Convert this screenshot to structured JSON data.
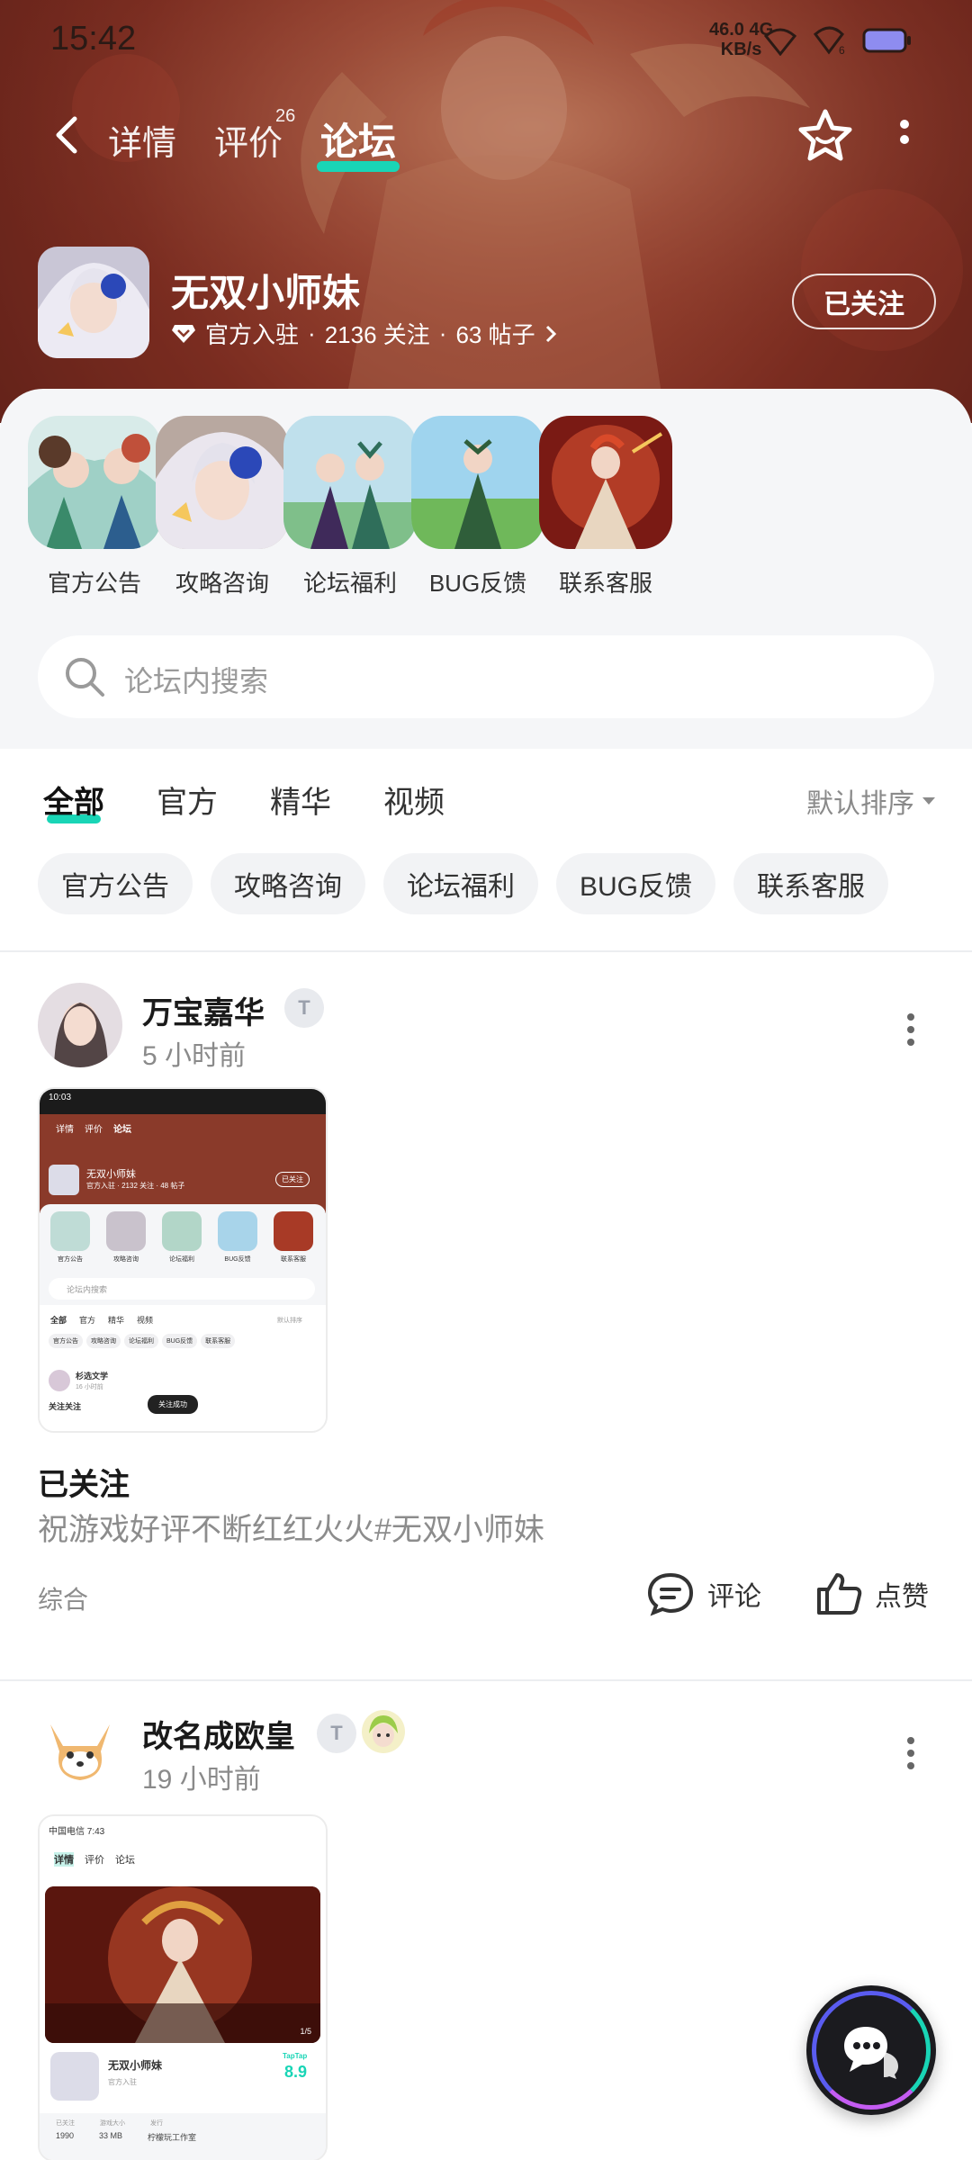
{
  "status_bar": {
    "time": "15:42",
    "net_speed_top": "46.0 4G",
    "net_speed_bottom": "KB/s",
    "signal_sub": "6"
  },
  "nav": {
    "tabs": [
      "详情",
      "评价",
      "论坛"
    ],
    "review_count": "26",
    "active_tab": "论坛"
  },
  "game": {
    "name": "无双小师妹",
    "badge": "官方入驻",
    "follows": "2136 关注",
    "posts": "63 帖子",
    "follow_button": "已关注"
  },
  "categories": [
    {
      "label": "官方公告",
      "icon": "announcement-art"
    },
    {
      "label": "攻略咨询",
      "icon": "guide-art"
    },
    {
      "label": "论坛福利",
      "icon": "welfare-art"
    },
    {
      "label": "BUG反馈",
      "icon": "bug-feedback-art"
    },
    {
      "label": "联系客服",
      "icon": "support-art"
    }
  ],
  "search": {
    "placeholder": "论坛内搜索"
  },
  "filter_tabs": [
    "全部",
    "官方",
    "精华",
    "视频"
  ],
  "sort_label": "默认排序",
  "chips": [
    "官方公告",
    "攻略咨询",
    "论坛福利",
    "BUG反馈",
    "联系客服"
  ],
  "posts": [
    {
      "author": "万宝嘉华",
      "badge": "T",
      "time": "5 小时前",
      "title": "已关注",
      "body": "祝游戏好评不断红红火火#无双小师妹",
      "tag": "综合",
      "comment_label": "评论",
      "like_label": "点赞",
      "screenshot": {
        "time": "10:03",
        "tabs": [
          "详情",
          "评价",
          "论坛"
        ],
        "game": "无双小师妹",
        "meta": "官方入驻 · 2132 关注 · 48 帖子",
        "follow": "已关注",
        "cats": [
          "官方公告",
          "攻略咨询",
          "论坛福利",
          "BUG反馈",
          "联系客服"
        ],
        "search": "论坛内搜索",
        "ftabs": [
          "全部",
          "官方",
          "精华",
          "视频"
        ],
        "sort": "默认排序",
        "chips": [
          "官方公告",
          "攻略咨询",
          "论坛福利",
          "BUG反馈",
          "联系客服"
        ],
        "author": "杉选文学",
        "ago": "16 小时前",
        "text": "关注关注",
        "toast": "关注成功"
      }
    },
    {
      "author": "改名成欧皇",
      "badge": "T",
      "time": "19 小时前",
      "screenshot": {
        "carrier": "中国电信 7:43",
        "tabs": [
          "详情",
          "评价",
          "论坛"
        ],
        "review_count": "26",
        "page": "1/5",
        "game": "无双小师妹",
        "official": "官方入驻",
        "brand": "TapTap",
        "score": "8.9",
        "stats_labels": [
          "已关注",
          "游戏大小",
          "发行"
        ],
        "stats_values": [
          "1990",
          "33 MB",
          "柠檬玩工作室"
        ]
      }
    }
  ],
  "colors": {
    "accent": "#19d5b6",
    "hero": "#8a3a2a"
  }
}
